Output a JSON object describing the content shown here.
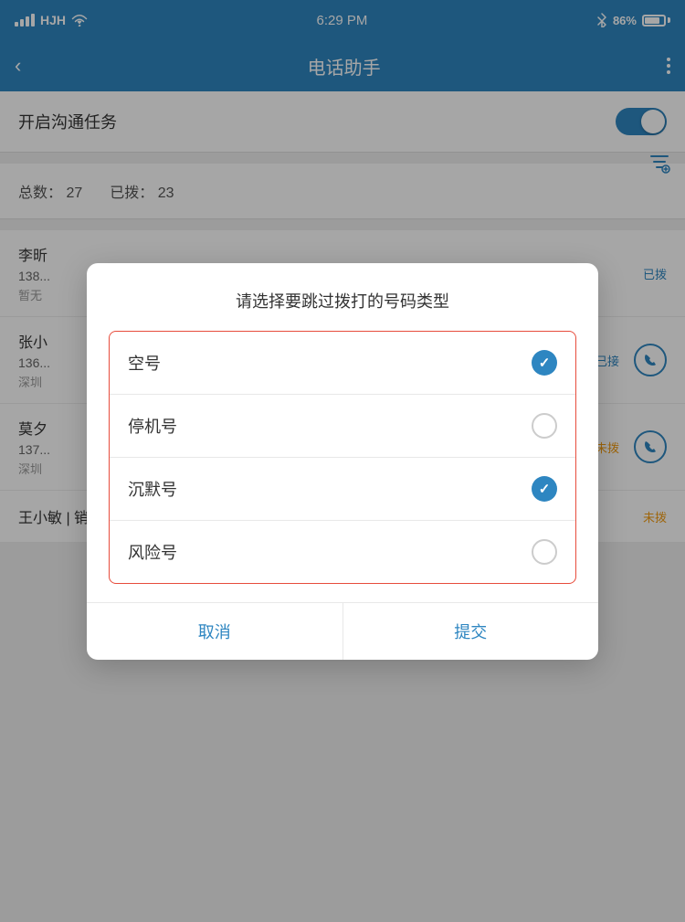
{
  "statusBar": {
    "carrier": "HJH",
    "time": "6:29 PM",
    "battery": "86%"
  },
  "navBar": {
    "title": "电话助手",
    "backLabel": "<",
    "moreLabel": "⋮"
  },
  "taskSection": {
    "label": "开启沟通任务",
    "toggleOn": true
  },
  "stats": {
    "totalLabel": "总数：",
    "totalValue": "27",
    "dialedLabel": "已拨：",
    "dialedValue": "23"
  },
  "contacts": [
    {
      "name": "李昕",
      "phone": "138...",
      "location": "暂无",
      "status": "已拨",
      "statusClass": "dialed",
      "hasPhone": false
    },
    {
      "name": "张小",
      "phone": "136...",
      "location": "深圳",
      "status": "已接",
      "statusClass": "dialed",
      "hasPhone": true
    },
    {
      "name": "莫夕",
      "phone": "137...",
      "location": "深圳",
      "status": "未拨",
      "statusClass": "undial",
      "hasPhone": true
    }
  ],
  "bottomContact": {
    "name": "王小敏 | 销售主管",
    "status": "未拨"
  },
  "modal": {
    "title": "请选择要跳过拨打的号码类型",
    "options": [
      {
        "label": "空号",
        "checked": true
      },
      {
        "label": "停机号",
        "checked": false
      },
      {
        "label": "沉默号",
        "checked": true
      },
      {
        "label": "风险号",
        "checked": false
      }
    ],
    "cancelLabel": "取消",
    "confirmLabel": "提交"
  }
}
